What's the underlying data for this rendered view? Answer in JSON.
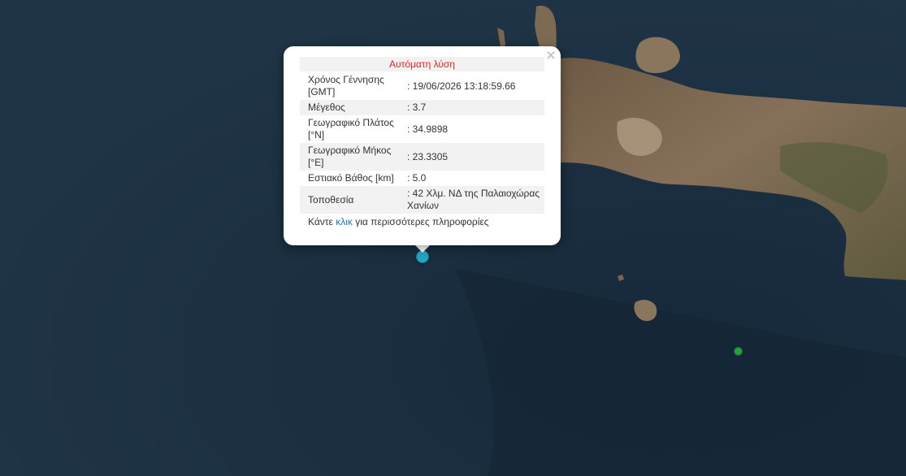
{
  "map": {
    "sea_color": "#1d3142",
    "land_color": "#7a6248",
    "land_highlight": "#a68d70",
    "land_forest": "#4f5a38"
  },
  "markers": {
    "main_color": "#27a4c2",
    "secondary_color": "#2c9b45"
  },
  "popup": {
    "title": "Αυτόματη λύση",
    "title_color": "#e0271e",
    "close_glyph": "×",
    "rows": [
      {
        "label": "Χρόνος Γέννησης [GMT]",
        "value": ": 19/06/2026 13:18:59.66"
      },
      {
        "label": "Μέγεθος",
        "value": ": 3.7"
      },
      {
        "label": "Γεωγραφικό Πλάτος [°N]",
        "value": ": 34.9898"
      },
      {
        "label": "Γεωγραφικό Μήκος [°E]",
        "value": ": 23.3305"
      },
      {
        "label": "Εστιακό Βάθος [km]",
        "value": ": 5.0"
      },
      {
        "label": "Τοποθεσία",
        "value": ": 42 Χλμ. ΝΔ της Παλαιοχώρας Χανίων"
      }
    ],
    "footer_before": "Κάντε ",
    "footer_link": "κλικ",
    "footer_after": " για περισσότερες πληροφορίες",
    "link_color": "#1a7ab8"
  }
}
